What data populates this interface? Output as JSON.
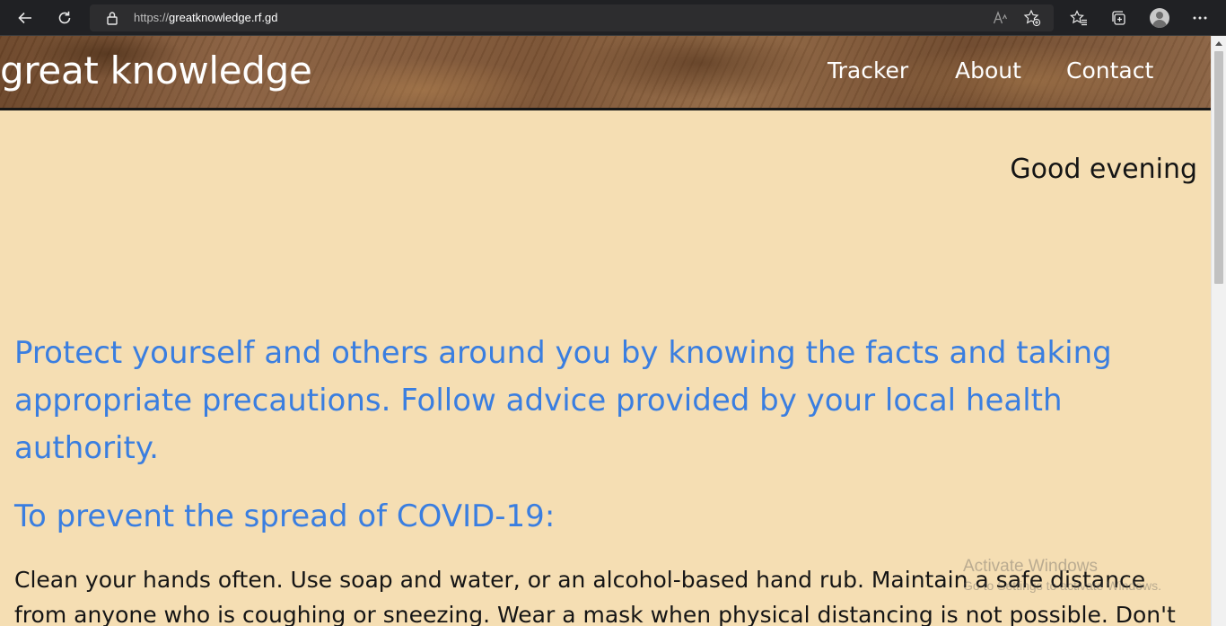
{
  "browser": {
    "url_prefix": "https://",
    "url_host": "greatknowledge.rf.gd",
    "icons": [
      "back-arrow-icon",
      "refresh-icon",
      "lock-icon",
      "read-aloud-icon",
      "add-favorite-icon",
      "favorites-icon",
      "collections-icon",
      "profile-avatar-icon",
      "more-menu-icon"
    ]
  },
  "site": {
    "brand": "great knowledge",
    "nav": [
      "Tracker",
      "About",
      "Contact"
    ]
  },
  "main": {
    "greeting": "Good evening",
    "intro": "Protect yourself and others around you by knowing the facts and taking appropriate precautions. Follow advice provided by your local health authority.",
    "subhead": "To prevent the spread of COVID-19:",
    "body": "Clean your hands often. Use soap and water, or an alcohol-based hand rub. Maintain a safe distance from anyone who is coughing or sneezing. Wear a mask when physical distancing is not possible. Don't"
  },
  "watermark": {
    "line1": "Activate Windows",
    "line2": "Go to Settings to activate Windows."
  },
  "colors": {
    "page_background": "#f5deb3",
    "heading_blue": "#3a7ee0",
    "body_text": "#151515"
  }
}
